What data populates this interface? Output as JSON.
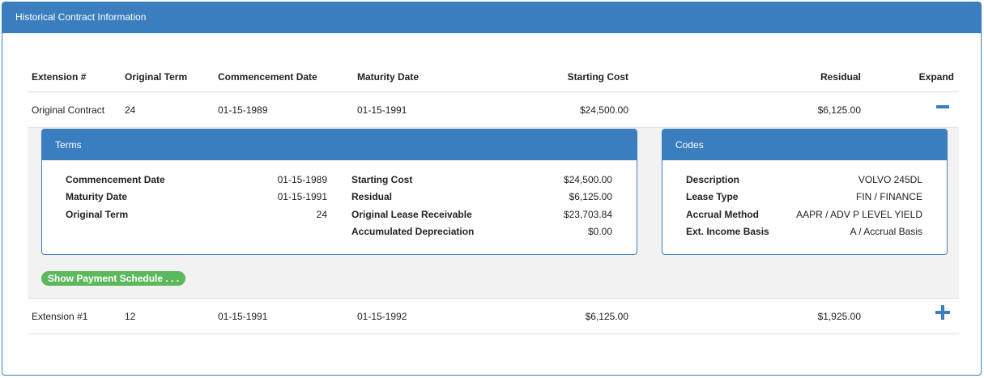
{
  "panel": {
    "title": "Historical Contract Information"
  },
  "table": {
    "headers": {
      "extension": "Extension #",
      "original_term": "Original Term",
      "commencement": "Commencement Date",
      "maturity": "Maturity Date",
      "starting_cost": "Starting Cost",
      "residual": "Residual",
      "expand": "Expand"
    },
    "rows": [
      {
        "extension": "Original Contract",
        "original_term": "24",
        "commencement": "01-15-1989",
        "maturity": "01-15-1991",
        "starting_cost": "$24,500.00",
        "residual": "$6,125.00",
        "expanded": true
      },
      {
        "extension": "Extension #1",
        "original_term": "12",
        "commencement": "01-15-1991",
        "maturity": "01-15-1992",
        "starting_cost": "$6,125.00",
        "residual": "$1,925.00",
        "expanded": false
      }
    ]
  },
  "terms": {
    "title": "Terms",
    "left": [
      {
        "label": "Commencement Date",
        "value": "01-15-1989"
      },
      {
        "label": "Maturity Date",
        "value": "01-15-1991"
      },
      {
        "label": "Original Term",
        "value": "24"
      }
    ],
    "right": [
      {
        "label": "Starting Cost",
        "value": "$24,500.00"
      },
      {
        "label": "Residual",
        "value": "$6,125.00"
      },
      {
        "label": "Original Lease Receivable",
        "value": "$23,703.84"
      },
      {
        "label": "Accumulated Depreciation",
        "value": "$0.00"
      }
    ]
  },
  "codes": {
    "title": "Codes",
    "items": [
      {
        "label": "Description",
        "value": "VOLVO 245DL"
      },
      {
        "label": "Lease Type",
        "value": "FIN / FINANCE"
      },
      {
        "label": "Accrual Method",
        "value": "AAPR / ADV P LEVEL YIELD"
      },
      {
        "label": "Ext. Income Basis",
        "value": "A / Accrual Basis"
      }
    ]
  },
  "buttons": {
    "payment_schedule": "Show Payment Schedule . . ."
  },
  "colors": {
    "primary": "#3a7ebf",
    "success": "#5cb85c",
    "detail_bg": "#f2f2f2"
  }
}
